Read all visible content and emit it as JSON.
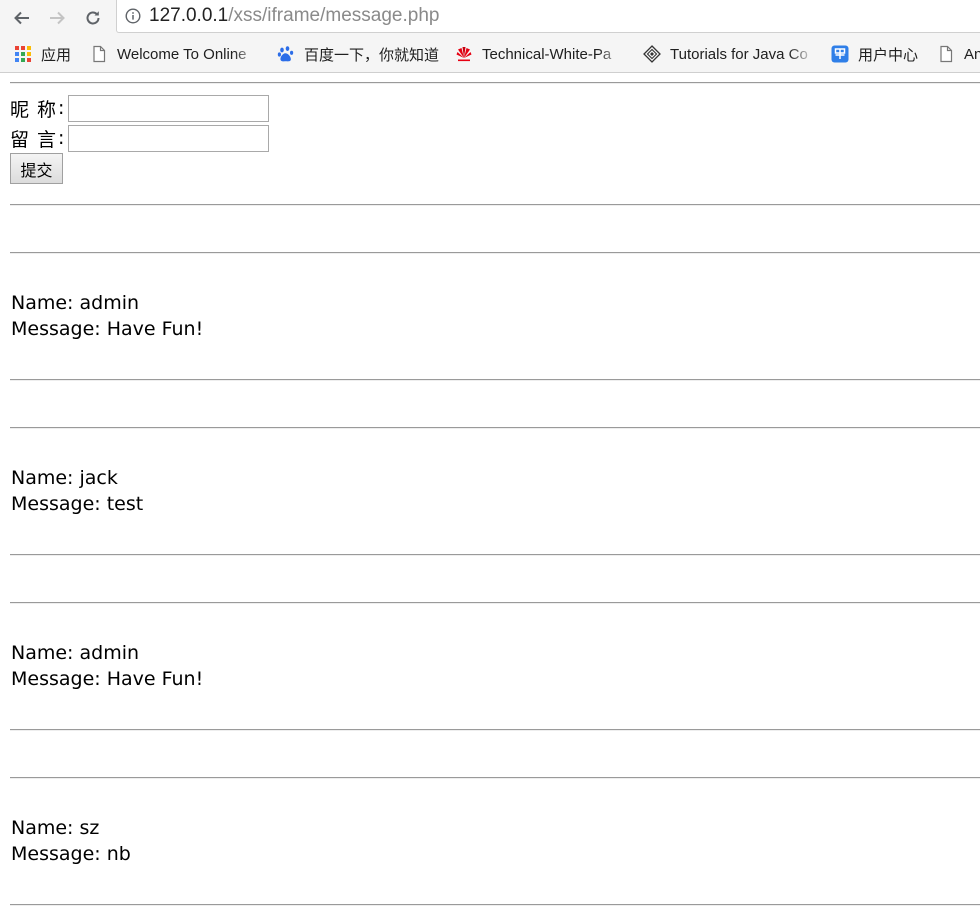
{
  "browser": {
    "url_host": "127.0.0.1",
    "url_path": "/xss/iframe/message.php",
    "bookmarks": [
      {
        "label": "应用",
        "icon": "apps-grid-icon"
      },
      {
        "label": "Welcome To Online",
        "icon": "page-icon"
      },
      {
        "label": "百度一下，你就知道",
        "icon": "baidu-paw-icon"
      },
      {
        "label": "Technical-White-Pa",
        "icon": "huawei-logo-icon"
      },
      {
        "label": "Tutorials for Java Co",
        "icon": "diamond-logo-icon"
      },
      {
        "label": "用户中心",
        "icon": "user-center-icon"
      },
      {
        "label": "An",
        "icon": "page-icon"
      }
    ]
  },
  "form": {
    "nickname_label": "昵称",
    "message_label": "留言",
    "colon": ":",
    "nickname_value": "",
    "message_value": "",
    "submit_label": "提交"
  },
  "messages": [
    {
      "name_line": "Name: admin",
      "message_line": "Message: Have Fun!"
    },
    {
      "name_line": "Name: jack",
      "message_line": "Message: test"
    },
    {
      "name_line": "Name: admin",
      "message_line": "Message: Have Fun!"
    },
    {
      "name_line": "Name: sz",
      "message_line": "Message: nb"
    }
  ]
}
